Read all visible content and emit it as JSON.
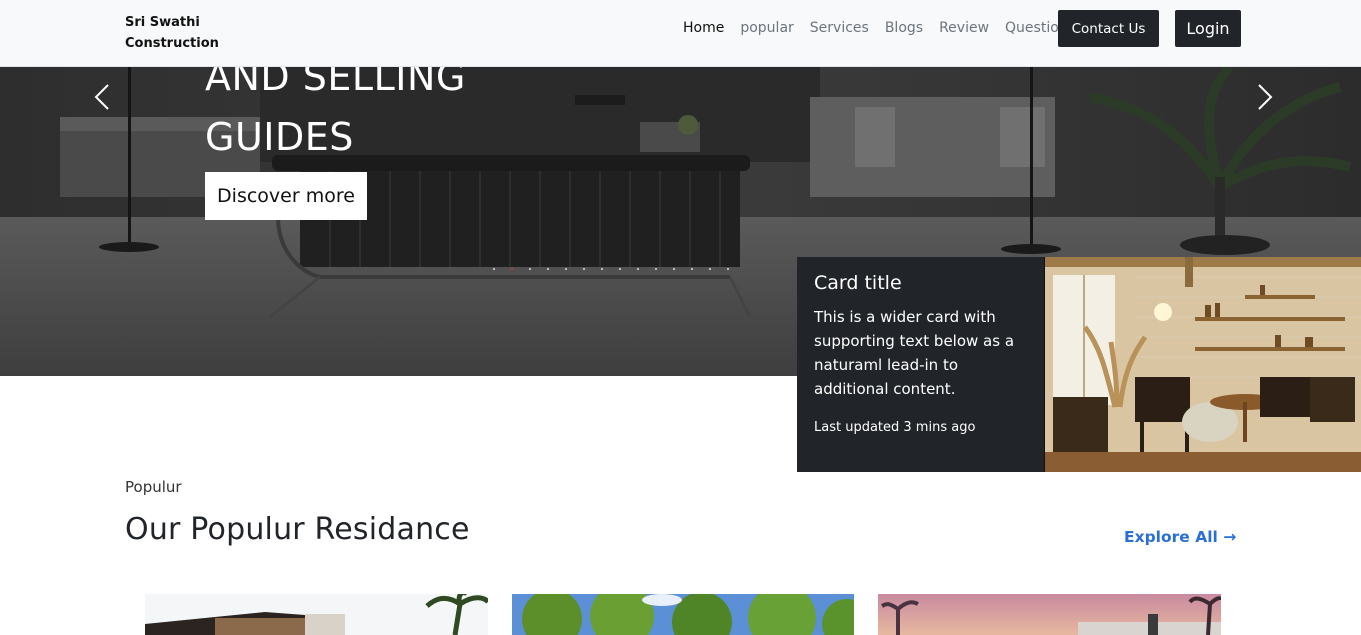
{
  "navbar": {
    "brand": "Sri Swathi\nConstruction",
    "links": [
      "Home",
      "popular",
      "Services",
      "Blogs",
      "Review",
      "Questions"
    ],
    "contact_label": "Contact Us",
    "login_label": "Login"
  },
  "hero": {
    "title": "AND SELLING\nGUIDES",
    "button_label": "Discover more"
  },
  "card": {
    "title": "Card title",
    "text": "This is a wider card with supporting text below as a naturaml lead-in to additional content.",
    "updated": "Last updated 3 mins ago"
  },
  "popular": {
    "eyebrow": "Populur",
    "title": "Our Populur Residance",
    "explore_label": "Explore All →"
  },
  "colors": {
    "navbar_bg": "#f8f9fa",
    "dark": "#212529",
    "link_blue": "#2a6fd6"
  }
}
